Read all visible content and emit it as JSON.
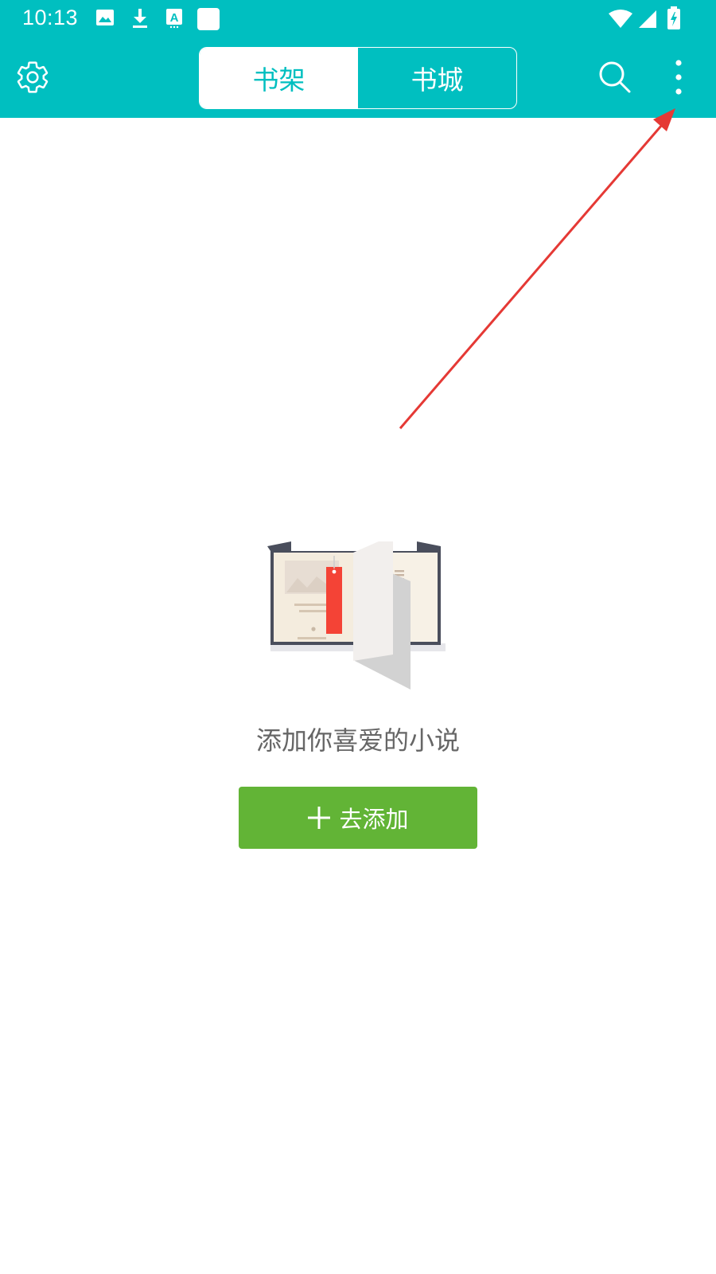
{
  "status_bar": {
    "time": "10:13",
    "notification_icons": [
      "image-icon",
      "download-icon",
      "font-icon",
      "blank-square-icon"
    ],
    "system_icons": [
      "wifi-icon",
      "signal-icon",
      "battery-charging-icon"
    ]
  },
  "app_bar": {
    "settings_icon": "gear-icon",
    "tabs": [
      {
        "label": "书架",
        "active": true
      },
      {
        "label": "书城",
        "active": false
      }
    ],
    "search_icon": "search-icon",
    "more_icon": "more-vertical-icon"
  },
  "empty_state": {
    "illustration": "open-book-icon",
    "message": "添加你喜爱的小说",
    "add_button_label": "去添加",
    "add_button_icon": "plus-icon"
  },
  "annotation": {
    "type": "arrow",
    "color": "#e53935",
    "target": "more-vertical-icon"
  },
  "colors": {
    "primary": "#00bfc0",
    "button_green": "#62b436",
    "text_gray": "#666666",
    "bookmark_red": "#f44336"
  }
}
